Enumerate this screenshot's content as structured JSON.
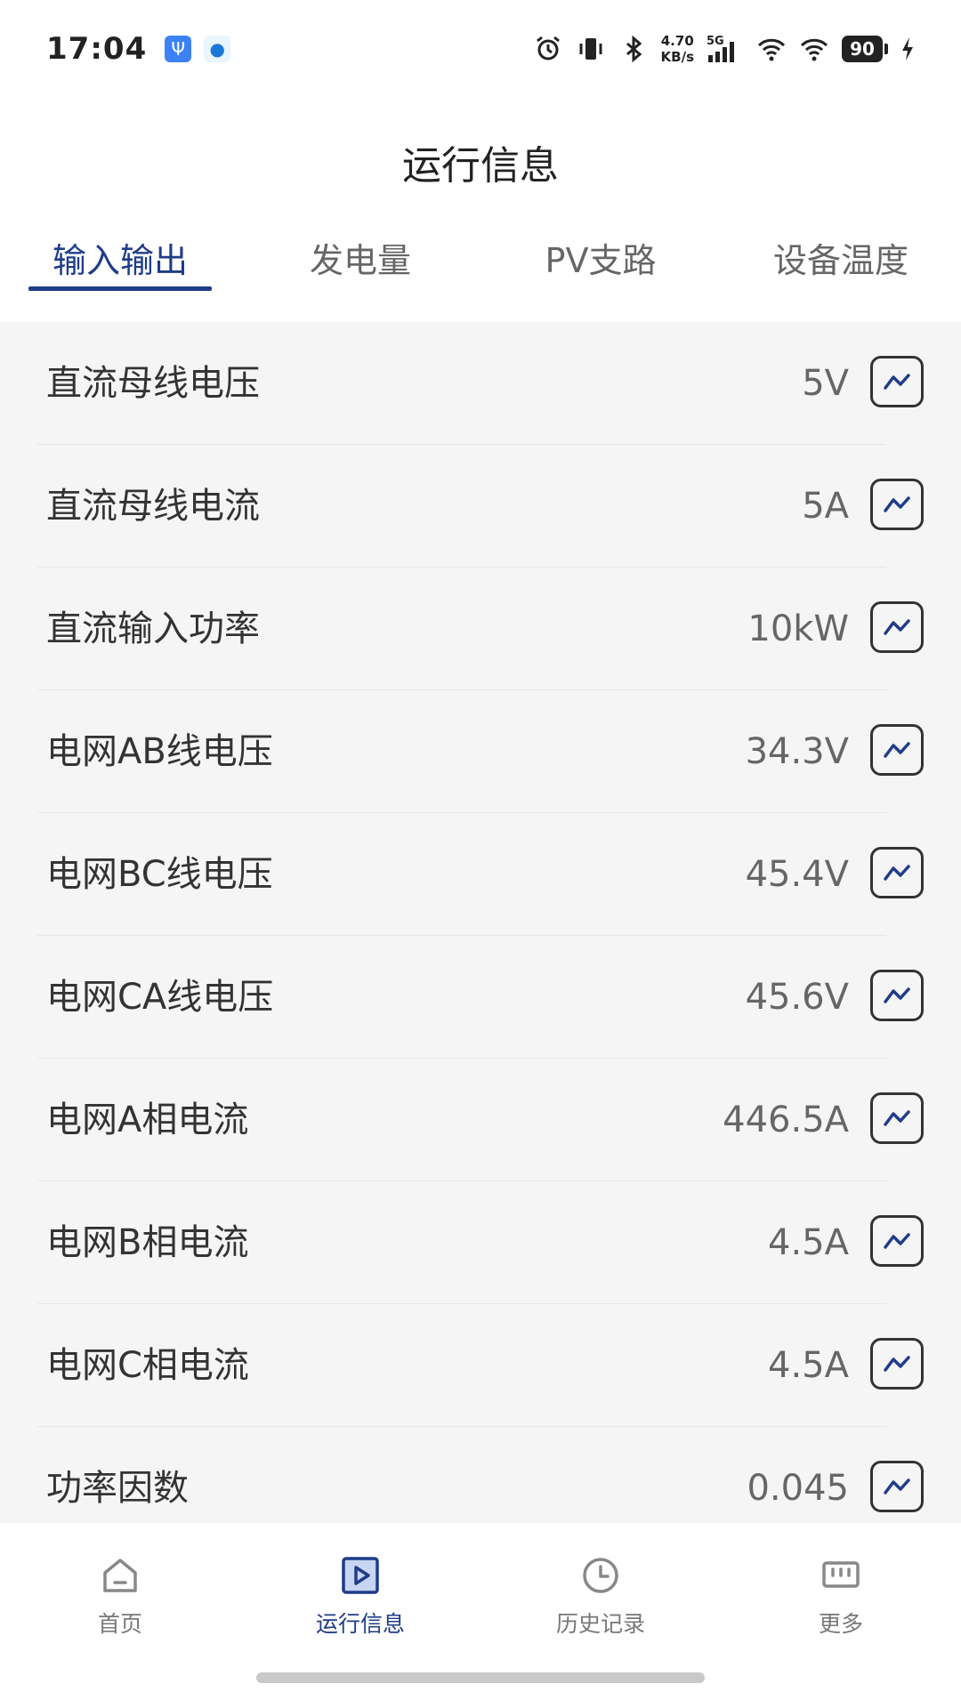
{
  "status_bar": {
    "time": "17:04",
    "net_speed_value": "4.70",
    "net_speed_unit": "KB/s",
    "network_type": "5G",
    "battery": "90"
  },
  "page": {
    "title": "运行信息"
  },
  "tabs": [
    {
      "label": "输入输出",
      "active": true
    },
    {
      "label": "发电量",
      "active": false
    },
    {
      "label": "PV支路",
      "active": false
    },
    {
      "label": "设备温度",
      "active": false
    }
  ],
  "rows": [
    {
      "label": "直流母线电压",
      "value": "5V"
    },
    {
      "label": "直流母线电流",
      "value": "5A"
    },
    {
      "label": "直流输入功率",
      "value": "10kW"
    },
    {
      "label": "电网AB线电压",
      "value": "34.3V"
    },
    {
      "label": "电网BC线电压",
      "value": "45.4V"
    },
    {
      "label": "电网CA线电压",
      "value": "45.6V"
    },
    {
      "label": "电网A相电流",
      "value": "446.5A"
    },
    {
      "label": "电网B相电流",
      "value": "4.5A"
    },
    {
      "label": "电网C相电流",
      "value": "4.5A"
    },
    {
      "label": "功率因数",
      "value": "0.045"
    }
  ],
  "bottom_nav": [
    {
      "label": "首页",
      "icon": "home-icon",
      "active": false
    },
    {
      "label": "运行信息",
      "icon": "play-square-icon",
      "active": true
    },
    {
      "label": "历史记录",
      "icon": "clock-icon",
      "active": false
    },
    {
      "label": "更多",
      "icon": "more-grid-icon",
      "active": false
    }
  ],
  "colors": {
    "accent": "#1f3c88",
    "list_background": "#f5f5f5",
    "text_primary": "#333333",
    "text_secondary": "#666666"
  }
}
